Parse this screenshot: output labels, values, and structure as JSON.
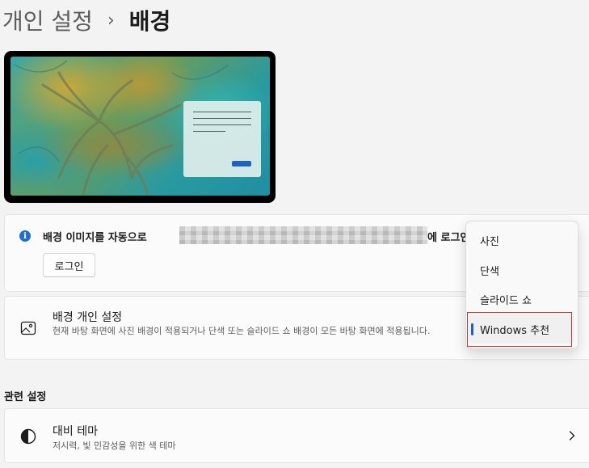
{
  "header": {
    "parent": "개인 설정",
    "separator": "›",
    "current": "배경"
  },
  "info_banner": {
    "text_start": "배경 이미지를 자동으로",
    "text_end": "에 로그인",
    "login_button": "로그인"
  },
  "personalize": {
    "title": "배경 개인 설정",
    "description": "현재 바탕 화면에 사진 배경이 적용되거나 단색 또는 슬라이드 쇼 배경이 모든 바탕 화면에 적용됩니다."
  },
  "related": {
    "section_title": "관련 설정",
    "contrast_title": "대비 테마",
    "contrast_desc": "저시력, 빛 민감성을 위한 색 테마"
  },
  "dropdown": {
    "options": [
      "사진",
      "단색",
      "슬라이드 쇼",
      "Windows 추천"
    ],
    "selected": "Windows 추천"
  },
  "colors": {
    "accent": "#1f5fbf",
    "highlight_border": "#d32f2f",
    "info_icon": "#1f6fd0"
  }
}
